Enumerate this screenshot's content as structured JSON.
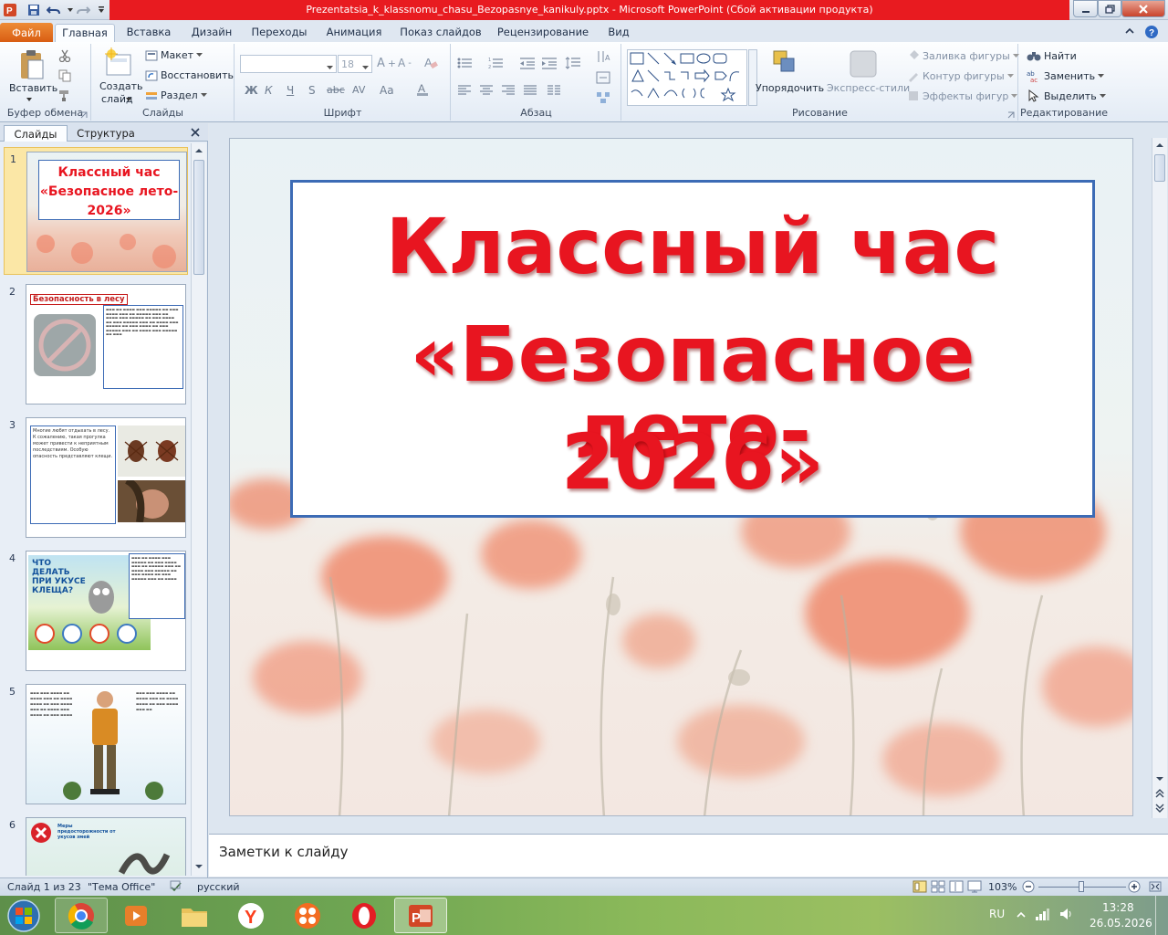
{
  "window": {
    "title": "Prezentatsia_k_klassnomu_chasu_Bezopasnye_kanikuly.pptx - Microsoft PowerPoint (Сбой активации продукта)"
  },
  "tabs": [
    "Файл",
    "Главная",
    "Вставка",
    "Дизайн",
    "Переходы",
    "Анимация",
    "Показ слайдов",
    "Рецензирование",
    "Вид"
  ],
  "ribbon": {
    "clipboard": {
      "paste": "Вставить",
      "group": "Буфер обмена"
    },
    "slides": {
      "new_slide_1": "Создать",
      "new_slide_2": "слайд",
      "layout": "Макет",
      "reset": "Восстановить",
      "section": "Раздел",
      "group": "Слайды"
    },
    "font": {
      "size": "18",
      "group": "Шрифт"
    },
    "paragraph": {
      "group": "Абзац"
    },
    "drawing": {
      "arrange": "Упорядочить",
      "quick_styles": "Экспресс-стили",
      "shape_fill": "Заливка фигуры",
      "shape_outline": "Контур фигуры",
      "shape_effects": "Эффекты фигур",
      "group": "Рисование"
    },
    "editing": {
      "find": "Найти",
      "replace": "Заменить",
      "select": "Выделить",
      "group": "Редактирование"
    }
  },
  "pane": {
    "tab_slides": "Слайды",
    "tab_outline": "Структура",
    "thumbs": [
      {
        "num": "1",
        "line1": "Классный час",
        "line2": "«Безопасное лето-",
        "line3": "2026»"
      },
      {
        "num": "2",
        "title": "Безопасность в лесу"
      },
      {
        "num": "3",
        "text": "Многие любят отдыхать в лесу. К сожалению, такая прогулка может привести к неприятным последствиям. Особую опасность представляют клещи."
      },
      {
        "num": "4",
        "title": "ЧТО ДЕЛАТЬ ПРИ УКУСЕ КЛЕЩА?"
      },
      {
        "num": "5"
      },
      {
        "num": "6",
        "title": "Меры предосторожности от укусов змей"
      }
    ]
  },
  "slide": {
    "line1": "Классный час",
    "line2": "«Безопасное лето-",
    "line3": "2026»"
  },
  "notes": {
    "placeholder": "Заметки к слайду"
  },
  "status": {
    "slide_counter": "Слайд 1 из 23",
    "theme": "\"Тема Office\"",
    "language": "русский",
    "zoom": "103%"
  },
  "taskbar": {
    "lang": "RU",
    "time": "13:28",
    "date": "26.05.2026"
  },
  "colors": {
    "title_red": "#e81520",
    "accent_border": "#3c6bb5",
    "file_tab": "#e06a1e"
  }
}
